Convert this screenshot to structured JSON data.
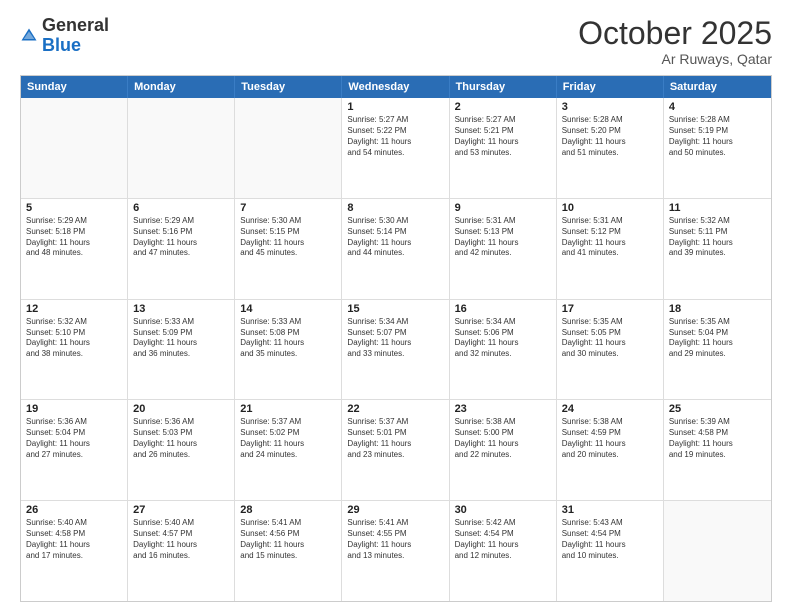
{
  "header": {
    "logo_general": "General",
    "logo_blue": "Blue",
    "month": "October 2025",
    "location": "Ar Ruways, Qatar"
  },
  "weekdays": [
    "Sunday",
    "Monday",
    "Tuesday",
    "Wednesday",
    "Thursday",
    "Friday",
    "Saturday"
  ],
  "weeks": [
    [
      {
        "day": "",
        "text": ""
      },
      {
        "day": "",
        "text": ""
      },
      {
        "day": "",
        "text": ""
      },
      {
        "day": "1",
        "text": "Sunrise: 5:27 AM\nSunset: 5:22 PM\nDaylight: 11 hours\nand 54 minutes."
      },
      {
        "day": "2",
        "text": "Sunrise: 5:27 AM\nSunset: 5:21 PM\nDaylight: 11 hours\nand 53 minutes."
      },
      {
        "day": "3",
        "text": "Sunrise: 5:28 AM\nSunset: 5:20 PM\nDaylight: 11 hours\nand 51 minutes."
      },
      {
        "day": "4",
        "text": "Sunrise: 5:28 AM\nSunset: 5:19 PM\nDaylight: 11 hours\nand 50 minutes."
      }
    ],
    [
      {
        "day": "5",
        "text": "Sunrise: 5:29 AM\nSunset: 5:18 PM\nDaylight: 11 hours\nand 48 minutes."
      },
      {
        "day": "6",
        "text": "Sunrise: 5:29 AM\nSunset: 5:16 PM\nDaylight: 11 hours\nand 47 minutes."
      },
      {
        "day": "7",
        "text": "Sunrise: 5:30 AM\nSunset: 5:15 PM\nDaylight: 11 hours\nand 45 minutes."
      },
      {
        "day": "8",
        "text": "Sunrise: 5:30 AM\nSunset: 5:14 PM\nDaylight: 11 hours\nand 44 minutes."
      },
      {
        "day": "9",
        "text": "Sunrise: 5:31 AM\nSunset: 5:13 PM\nDaylight: 11 hours\nand 42 minutes."
      },
      {
        "day": "10",
        "text": "Sunrise: 5:31 AM\nSunset: 5:12 PM\nDaylight: 11 hours\nand 41 minutes."
      },
      {
        "day": "11",
        "text": "Sunrise: 5:32 AM\nSunset: 5:11 PM\nDaylight: 11 hours\nand 39 minutes."
      }
    ],
    [
      {
        "day": "12",
        "text": "Sunrise: 5:32 AM\nSunset: 5:10 PM\nDaylight: 11 hours\nand 38 minutes."
      },
      {
        "day": "13",
        "text": "Sunrise: 5:33 AM\nSunset: 5:09 PM\nDaylight: 11 hours\nand 36 minutes."
      },
      {
        "day": "14",
        "text": "Sunrise: 5:33 AM\nSunset: 5:08 PM\nDaylight: 11 hours\nand 35 minutes."
      },
      {
        "day": "15",
        "text": "Sunrise: 5:34 AM\nSunset: 5:07 PM\nDaylight: 11 hours\nand 33 minutes."
      },
      {
        "day": "16",
        "text": "Sunrise: 5:34 AM\nSunset: 5:06 PM\nDaylight: 11 hours\nand 32 minutes."
      },
      {
        "day": "17",
        "text": "Sunrise: 5:35 AM\nSunset: 5:05 PM\nDaylight: 11 hours\nand 30 minutes."
      },
      {
        "day": "18",
        "text": "Sunrise: 5:35 AM\nSunset: 5:04 PM\nDaylight: 11 hours\nand 29 minutes."
      }
    ],
    [
      {
        "day": "19",
        "text": "Sunrise: 5:36 AM\nSunset: 5:04 PM\nDaylight: 11 hours\nand 27 minutes."
      },
      {
        "day": "20",
        "text": "Sunrise: 5:36 AM\nSunset: 5:03 PM\nDaylight: 11 hours\nand 26 minutes."
      },
      {
        "day": "21",
        "text": "Sunrise: 5:37 AM\nSunset: 5:02 PM\nDaylight: 11 hours\nand 24 minutes."
      },
      {
        "day": "22",
        "text": "Sunrise: 5:37 AM\nSunset: 5:01 PM\nDaylight: 11 hours\nand 23 minutes."
      },
      {
        "day": "23",
        "text": "Sunrise: 5:38 AM\nSunset: 5:00 PM\nDaylight: 11 hours\nand 22 minutes."
      },
      {
        "day": "24",
        "text": "Sunrise: 5:38 AM\nSunset: 4:59 PM\nDaylight: 11 hours\nand 20 minutes."
      },
      {
        "day": "25",
        "text": "Sunrise: 5:39 AM\nSunset: 4:58 PM\nDaylight: 11 hours\nand 19 minutes."
      }
    ],
    [
      {
        "day": "26",
        "text": "Sunrise: 5:40 AM\nSunset: 4:58 PM\nDaylight: 11 hours\nand 17 minutes."
      },
      {
        "day": "27",
        "text": "Sunrise: 5:40 AM\nSunset: 4:57 PM\nDaylight: 11 hours\nand 16 minutes."
      },
      {
        "day": "28",
        "text": "Sunrise: 5:41 AM\nSunset: 4:56 PM\nDaylight: 11 hours\nand 15 minutes."
      },
      {
        "day": "29",
        "text": "Sunrise: 5:41 AM\nSunset: 4:55 PM\nDaylight: 11 hours\nand 13 minutes."
      },
      {
        "day": "30",
        "text": "Sunrise: 5:42 AM\nSunset: 4:54 PM\nDaylight: 11 hours\nand 12 minutes."
      },
      {
        "day": "31",
        "text": "Sunrise: 5:43 AM\nSunset: 4:54 PM\nDaylight: 11 hours\nand 10 minutes."
      },
      {
        "day": "",
        "text": ""
      }
    ]
  ]
}
